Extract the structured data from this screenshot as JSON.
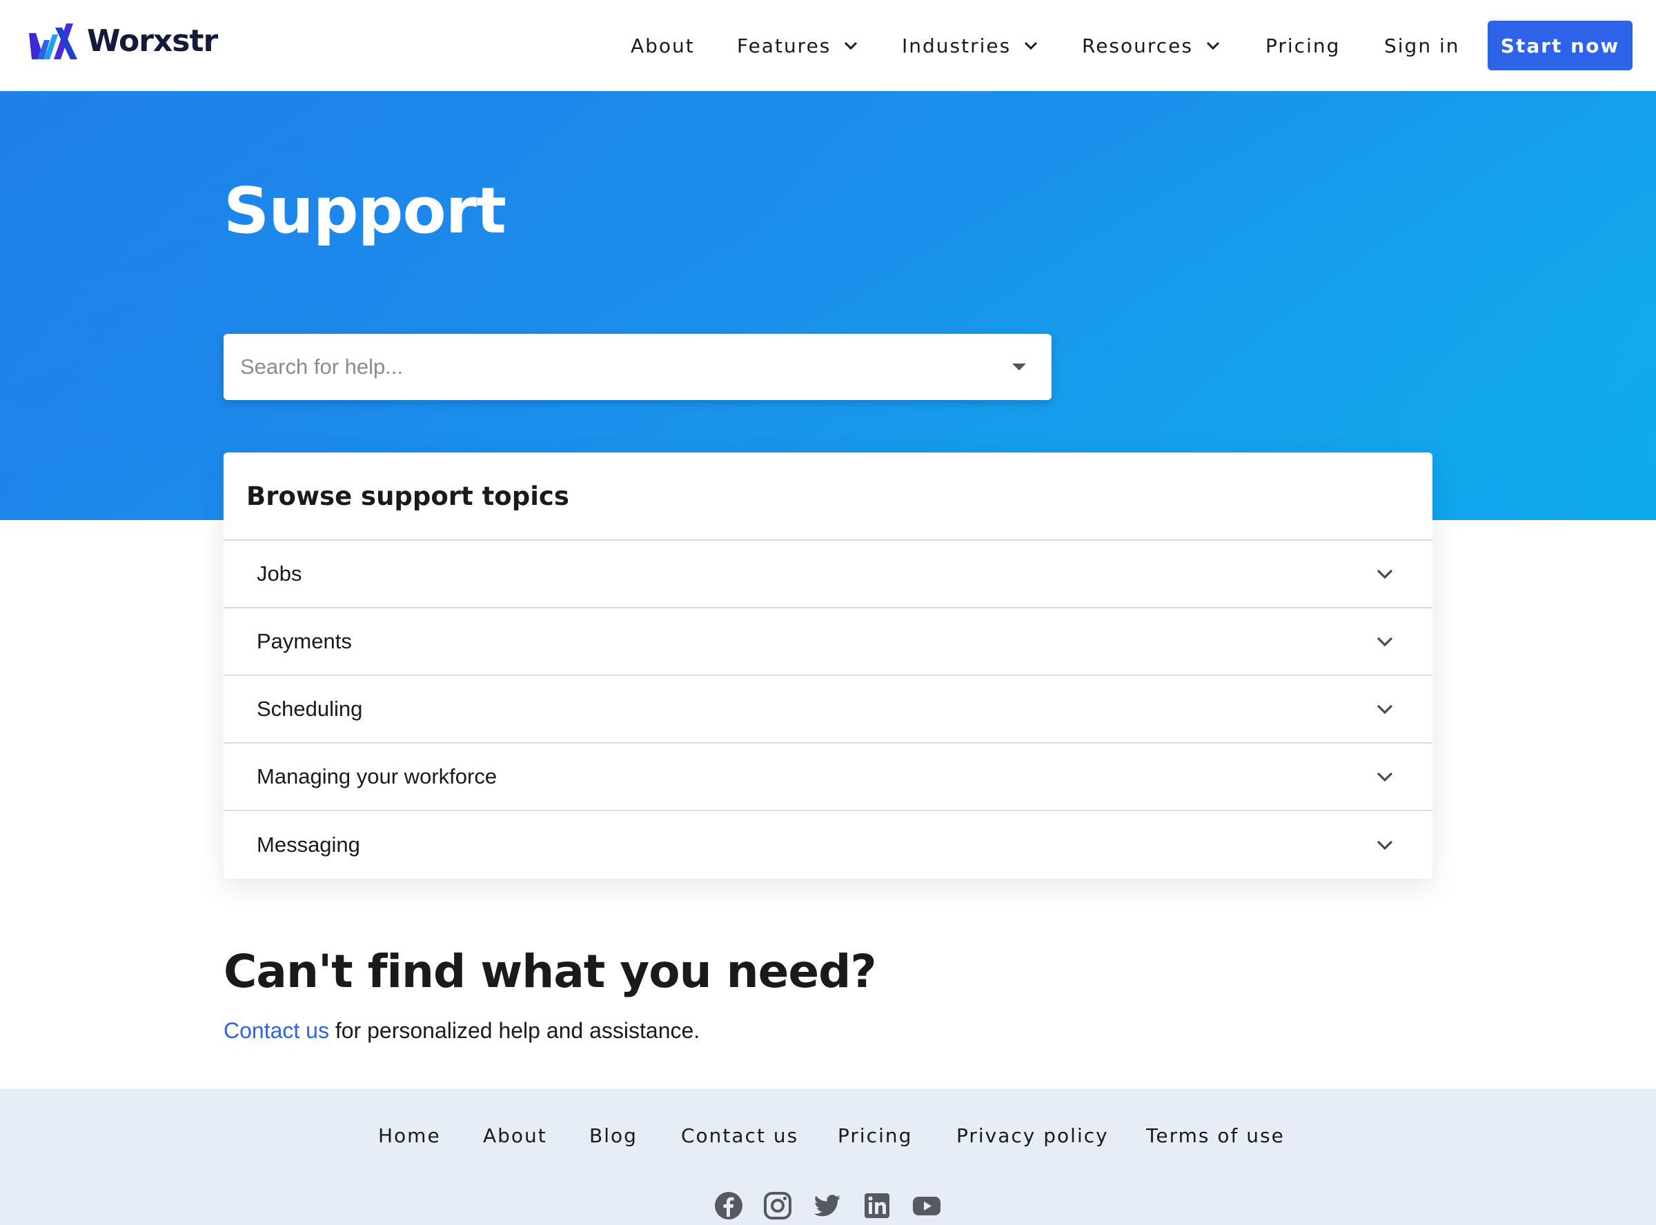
{
  "brand": {
    "name": "Worxstr"
  },
  "nav": {
    "items": [
      {
        "label": "About",
        "has_dropdown": false
      },
      {
        "label": "Features",
        "has_dropdown": true
      },
      {
        "label": "Industries",
        "has_dropdown": true
      },
      {
        "label": "Resources",
        "has_dropdown": true
      },
      {
        "label": "Pricing",
        "has_dropdown": false
      },
      {
        "label": "Sign in",
        "has_dropdown": false
      }
    ],
    "cta_label": "Start now"
  },
  "hero": {
    "title": "Support",
    "search_placeholder": "Search for help..."
  },
  "topics": {
    "title": "Browse support topics",
    "items": [
      {
        "label": "Jobs"
      },
      {
        "label": "Payments"
      },
      {
        "label": "Scheduling"
      },
      {
        "label": "Managing your workforce"
      },
      {
        "label": "Messaging"
      }
    ]
  },
  "help": {
    "heading": "Can't find what you need?",
    "link_text": "Contact us",
    "rest_text": " for personalized help and assistance."
  },
  "footer": {
    "links": [
      {
        "label": "Home"
      },
      {
        "label": "About"
      },
      {
        "label": "Blog"
      },
      {
        "label": "Contact us"
      },
      {
        "label": "Pricing"
      },
      {
        "label": "Privacy policy"
      },
      {
        "label": "Terms of use"
      }
    ],
    "socials": [
      "facebook-icon",
      "instagram-icon",
      "twitter-icon",
      "linkedin-icon",
      "youtube-icon"
    ]
  },
  "colors": {
    "accent": "#2d63e8",
    "hero_gradient_start": "#1f80ea",
    "hero_gradient_end": "#06c0f0",
    "footer_bg": "#e6edf6",
    "text": "#1a1a1a"
  }
}
